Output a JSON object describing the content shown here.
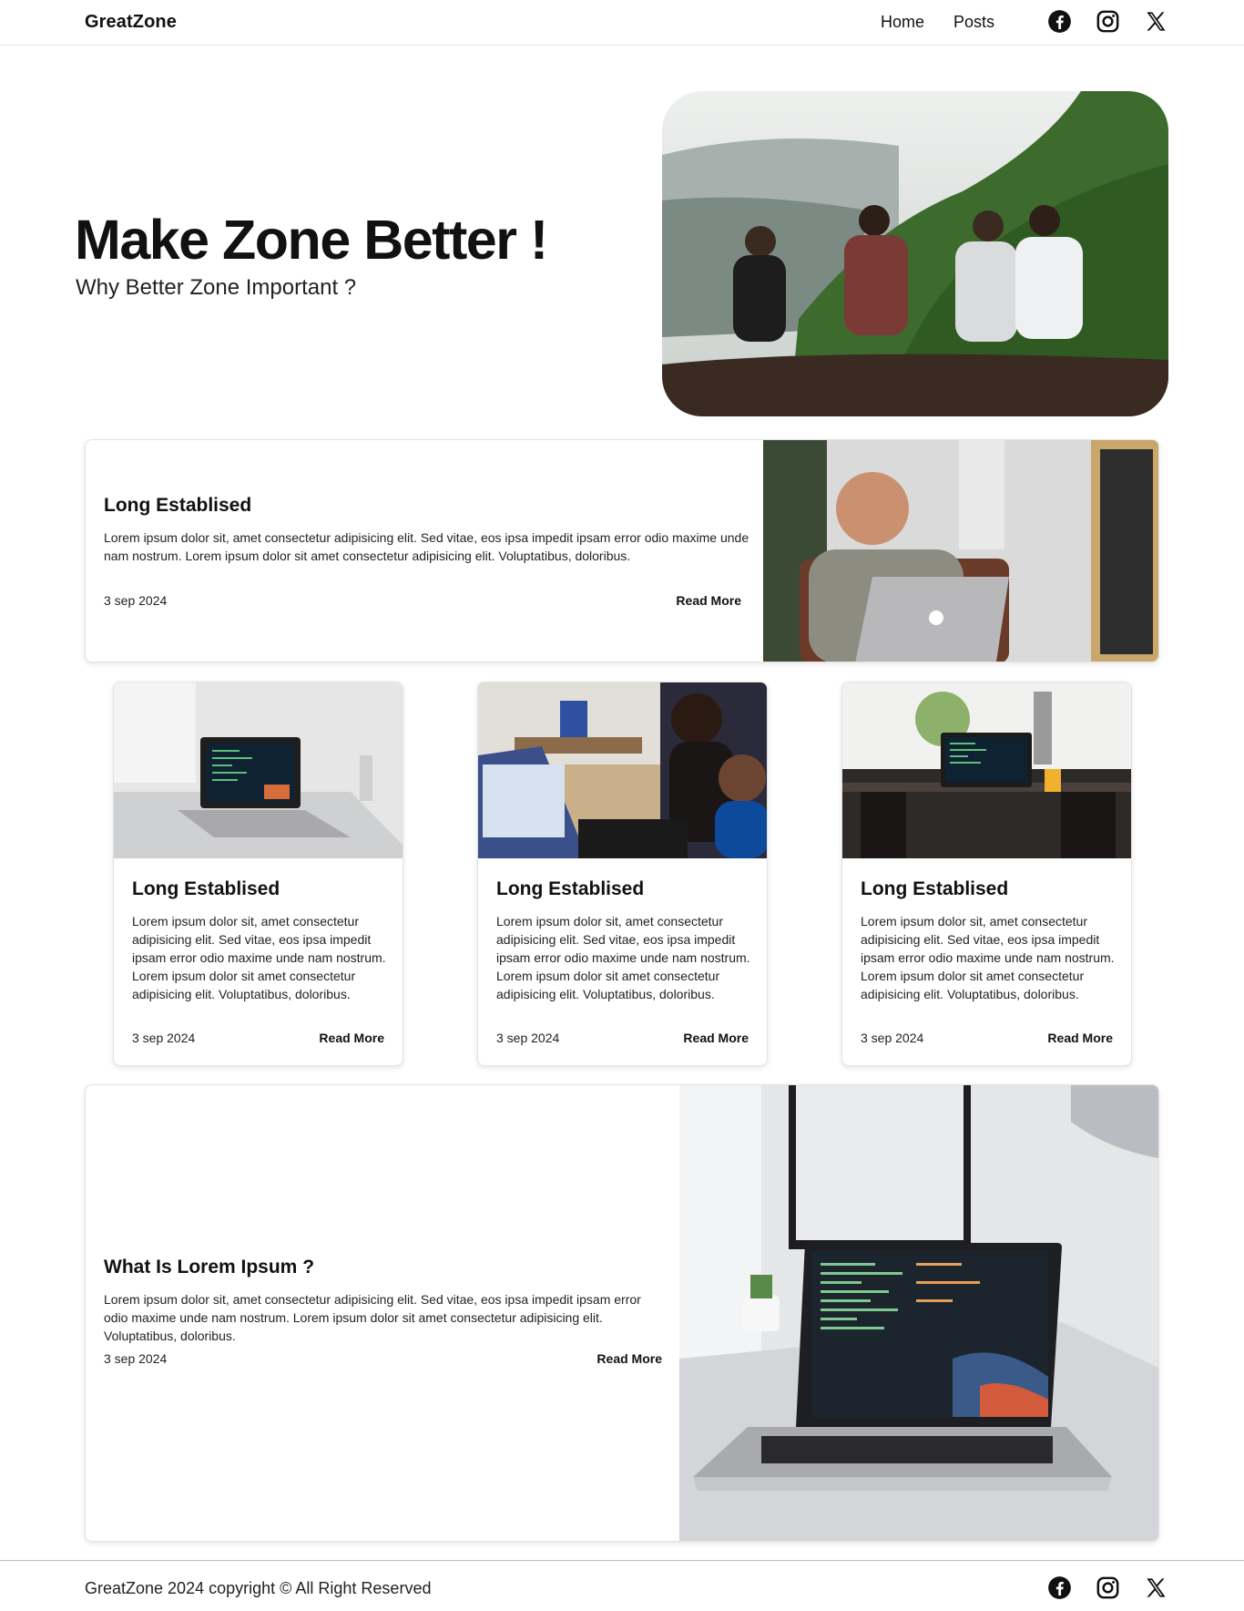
{
  "header": {
    "brand": "GreatZone",
    "nav": [
      {
        "label": "Home"
      },
      {
        "label": "Posts"
      }
    ],
    "social": [
      "facebook-icon",
      "instagram-icon",
      "x-icon"
    ]
  },
  "hero": {
    "title": "Make Zone Better !",
    "subtitle": "Why Better Zone Important ?"
  },
  "featured_top": {
    "title": "Long Establised",
    "text": "Lorem ipsum dolor sit, amet consectetur adipisicing elit. Sed vitae, eos ipsa impedit ipsam error odio maxime unde nam nostrum. Lorem ipsum dolor sit amet consectetur adipisicing elit. Voluptatibus, doloribus.",
    "date": "3 sep 2024",
    "cta": "Read More"
  },
  "cards": [
    {
      "title": "Long Establised",
      "text": "Lorem ipsum dolor sit, amet consectetur adipisicing elit. Sed vitae, eos ipsa impedit ipsam error odio maxime unde nam nostrum. Lorem ipsum dolor sit amet consectetur adipisicing elit. Voluptatibus, doloribus.",
      "date": "3 sep 2024",
      "cta": "Read More"
    },
    {
      "title": "Long Establised",
      "text": "Lorem ipsum dolor sit, amet consectetur adipisicing elit. Sed vitae, eos ipsa impedit ipsam error odio maxime unde nam nostrum. Lorem ipsum dolor sit amet consectetur adipisicing elit. Voluptatibus, doloribus.",
      "date": "3 sep 2024",
      "cta": "Read More"
    },
    {
      "title": "Long Establised",
      "text": "Lorem ipsum dolor sit, amet consectetur adipisicing elit. Sed vitae, eos ipsa impedit ipsam error odio maxime unde nam nostrum. Lorem ipsum dolor sit amet consectetur adipisicing elit. Voluptatibus, doloribus.",
      "date": "3 sep 2024",
      "cta": "Read More"
    }
  ],
  "featured_bottom": {
    "title": "What Is Lorem Ipsum ?",
    "text": "Lorem ipsum dolor sit, amet consectetur adipisicing elit. Sed vitae, eos ipsa impedit ipsam error odio maxime unde nam nostrum. Lorem ipsum dolor sit amet consectetur adipisicing elit. Voluptatibus, doloribus.",
    "date": "3 sep 2024",
    "cta": "Read More"
  },
  "footer": {
    "copyright": "GreatZone 2024 copyright © All Right Reserved"
  }
}
